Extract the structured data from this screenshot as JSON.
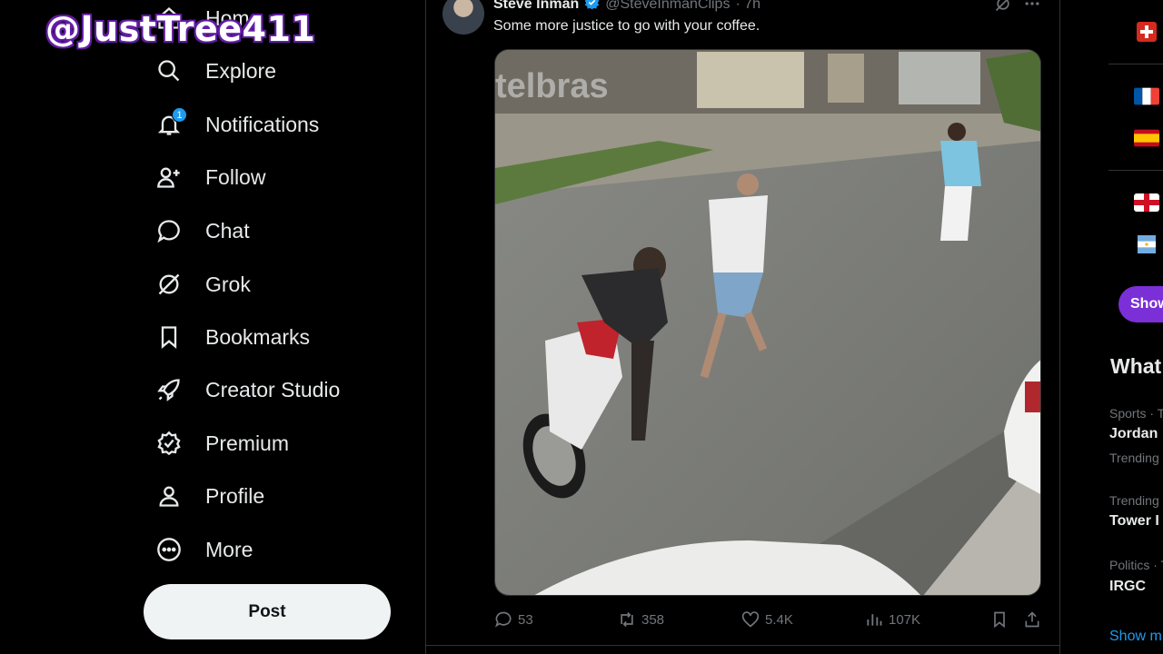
{
  "overlay": {
    "watermark": "@JustTree411"
  },
  "nav": {
    "items": [
      {
        "label": "Home",
        "icon": "home-icon"
      },
      {
        "label": "Explore",
        "icon": "search-icon"
      },
      {
        "label": "Notifications",
        "icon": "bell-icon",
        "badge": "1"
      },
      {
        "label": "Follow",
        "icon": "follow-icon"
      },
      {
        "label": "Chat",
        "icon": "chat-icon"
      },
      {
        "label": "Grok",
        "icon": "grok-icon"
      },
      {
        "label": "Bookmarks",
        "icon": "bookmark-icon"
      },
      {
        "label": "Creator Studio",
        "icon": "rocket-icon"
      },
      {
        "label": "Premium",
        "icon": "premium-icon"
      },
      {
        "label": "Profile",
        "icon": "profile-icon"
      },
      {
        "label": "More",
        "icon": "more-circle-icon"
      }
    ],
    "post_label": "Post"
  },
  "tweet": {
    "author": "Steve Inman",
    "handle": "@SteveInmanClips",
    "time": "· 7h",
    "text": "Some more justice to go with your coffee.",
    "media_watermark": "telbras",
    "stats": {
      "replies": "53",
      "reposts": "358",
      "likes": "5.4K",
      "views": "107K"
    }
  },
  "right": {
    "show_label": "Show",
    "whats_heading": "What",
    "trends": [
      {
        "meta": "Sports · T",
        "title": "Jordan",
        "sub": "Trending"
      },
      {
        "meta": "Trending",
        "title": "Tower I"
      },
      {
        "meta": "Politics · T",
        "title": "IRGC"
      }
    ],
    "show_more": "Show m"
  },
  "colors": {
    "accent": "#1d9bf0",
    "purple_pill": "#7b2fd6",
    "background": "#000000"
  }
}
